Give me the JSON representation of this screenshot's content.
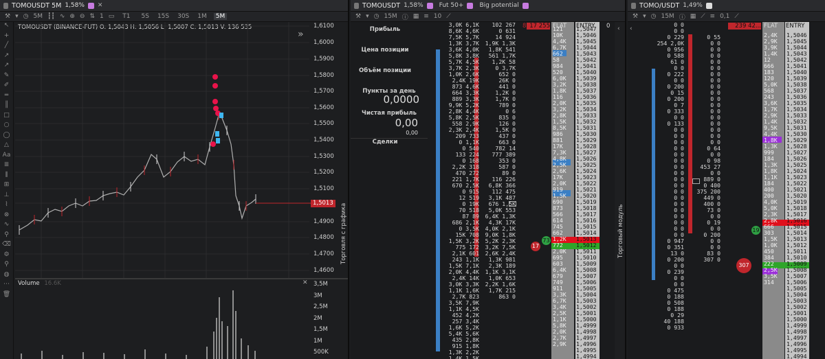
{
  "colors": {
    "bg": "#1c1d1f",
    "bid": "#3b7fc4",
    "ask": "#c0262c",
    "green": "#2ea043",
    "purple": "#9b30d9"
  },
  "p1": {
    "tab_title": "TOMOUSDT 5M",
    "tab_pct": "1,58%",
    "tf_active": "5M",
    "timeframes": [
      "T1",
      "5S",
      "15S",
      "30S",
      "1M",
      "5M"
    ],
    "interval": "5M",
    "count": "1",
    "ohlc": "TOMOUSDT (BINANCE-FUT) O: 1,5043  H: 1,5056  L: 1,5007  C: 1,5013  V: 136 535",
    "prices": [
      "1,6100",
      "1,6000",
      "1,5900",
      "1,5800",
      "1,5700",
      "1,5600",
      "1,5500",
      "1,5400",
      "1,5300",
      "1,5200",
      "1,5100",
      "1,5013",
      "1,4900",
      "1,4800",
      "1,4700",
      "1,4600"
    ],
    "current_price": "1,5013",
    "volume_label": "Volume",
    "volume_value": "16.6K",
    "vol_axis": [
      "3,5M",
      "3M",
      "2,5M",
      "2M",
      "1,5M",
      "1M",
      "500K"
    ],
    "vert_label": "Торговля с графика",
    "tools": [
      "cursor",
      "cross",
      "line",
      "ray",
      "arrow",
      "pencil",
      "brush",
      "hline",
      "vline",
      "rect",
      "circle",
      "ellipse",
      "triangle",
      "text",
      "fib",
      "channel",
      "measure",
      "ruler",
      "trash",
      "lock",
      "eye",
      "magnet",
      "eraser",
      "settings",
      "zoom",
      "hide",
      "more",
      "delete"
    ]
  },
  "p2": {
    "tab_title": "TOMOUSDT",
    "tab_pct": "1,58%",
    "tab2": "Fut 50+",
    "tab3": "Big potential",
    "interval": "15M",
    "count": "10",
    "header": {
      "bids": "8",
      "asks": "17 255",
      "flat": "FLAT",
      "entry": "ENTRY",
      "zero": "0"
    },
    "labels": {
      "profit": "Прибыль",
      "pos_price": "Цена позиции",
      "pos_vol": "Объём позиции",
      "day_points": "Пункты за день",
      "day_points_val": "0,0000",
      "net_profit": "Чистая прибыль",
      "net_val": "0,00",
      "net_sub": "0,00",
      "deals": "Сделки"
    },
    "circles": [
      "17",
      "73"
    ],
    "vert_label": "Торговый модуль",
    "c1": [
      "3,0K 6,1K",
      "8,6K 4,6K",
      "7,5K 5,7K",
      "1,3K 3,7K",
      "3,6K 4,0K",
      "5,8K 3,8K",
      "5,7K 4,5K",
      "3,7K 2,3K",
      "1,0K 2,6K",
      "2,4K 19K",
      "873 4,6K",
      "664 3,3K",
      "889 3,3K",
      "9,9K 5,2K",
      "2,8K 4,4K",
      "5,8K 2,5K",
      "558 2,9K",
      "2,3K 2,4K",
      "209 733",
      "0 1,1K",
      "0 540",
      "133 224",
      "0 168",
      "2,2K 318",
      "470 272",
      "221 1,7K",
      "670 2,5K",
      "0 915",
      "12 519",
      "0 19K",
      "70 518",
      "87 89",
      "686 2,1K",
      "0 3,5K",
      "15K 708",
      "1,5K 3,2K",
      "775 172",
      "2,1K 601",
      "243 1,1K",
      "1,5K 7,1K",
      "2,0K 4,4K",
      "2,4K 14K",
      "3,0K 3,3K",
      "1,1K 1,6K",
      "2,7K 823",
      "3,5K 7,9K",
      "1,1K 4,5K",
      "452 4,2K",
      "257 3,4K",
      "1,6K 5,2K",
      "5,4K 5,6K",
      "435 2,8K",
      "915 1,8K",
      "1,3K 2,2K",
      "1,4K 1,5K",
      "1,9K 3,5K",
      "1,8K 23K"
    ],
    "c2": [
      "102 267",
      "0 631",
      "14 924",
      "1,9K 1,3K",
      "1,8K 541",
      "561 1,7K",
      "1,2K 58",
      "0 3,7K",
      "652 0",
      "26K 0",
      "441 0",
      "1,2K 0",
      "1,7K 0",
      "789 0",
      "0 6",
      "835 0",
      "126 0",
      "1,5K 0",
      "437 0",
      "663 0",
      "782 14",
      "777 389",
      "353 0",
      "587 0",
      "89 0",
      "116 226",
      "6,8K 366",
      "112 475",
      "3,1K 487",
      "676 1,5K",
      "5,0K 553",
      "6,4K 1,3K",
      "4,3K 17K",
      "4,0K 2,1K",
      "9,0K 1,8K",
      "5,2K 2,3K",
      "3,2K 7,5K",
      "2,6K 2,4K",
      "1,3K 981",
      "2,3K 189",
      "1,1K 3,1K",
      "1,0K 653",
      "2,2K 1,6K",
      "1,7K 215",
      "863 0"
    ],
    "asks": [
      "",
      "",
      "",
      "121",
      "10K",
      "4,4K",
      "6,7K",
      "662",
      "58",
      "984",
      "520",
      "6,0K",
      "3,2K",
      "1,8K",
      "116",
      "2,0K",
      "3,2K",
      "2,8K",
      "1,5K",
      "8,5K",
      "986",
      "881",
      "17K",
      "7,3K",
      "4,8K",
      "2,5K",
      "2,6K",
      "17K",
      "2,0K",
      "919",
      "1,5K",
      "690",
      "873",
      "566",
      "614",
      "745",
      "662",
      "1,2K",
      "772",
      "2,0K",
      "695",
      "603",
      "6,4K",
      "679",
      "749",
      "911",
      "3,3K",
      "6,7K",
      "3,4K",
      "2,5K",
      "1,1K",
      "5,8K",
      "2,0K",
      "2,7K",
      "2,9K"
    ],
    "prices": [
      "1,5047",
      "1,5046",
      "1,5045",
      "1,5044",
      "1,5043",
      "1,5042",
      "1,5041",
      "1,5040",
      "1,5039",
      "1,5038",
      "1,5037",
      "1,5036",
      "1,5035",
      "1,5034",
      "1,5033",
      "1,5032",
      "1,5031",
      "1,5030",
      "1,5029",
      "1,5028",
      "1,5027",
      "1,5026",
      "1,5025",
      "1,5024",
      "1,5023",
      "1,5022",
      "1,5021",
      "1,5020",
      "1,5019",
      "1,5018",
      "1,5017",
      "1,5016",
      "1,5015",
      "1,5014",
      "1,5013",
      "1,5012",
      "1,5011",
      "1,5010",
      "1,5009",
      "1,5008",
      "1,5007",
      "1,5006",
      "1,5005",
      "1,5004",
      "1,5003",
      "1,5002",
      "1,5001",
      "1,5000",
      "1,4999",
      "1,4998",
      "1,4997",
      "1,4996",
      "1,4995",
      "1,4994"
    ]
  },
  "p3": {
    "tab_title": "TOMO/USDT",
    "tab_pct": "1,49%",
    "interval": "15M",
    "count": "0,1",
    "header": {
      "asks": "239 42...",
      "flat": "FLAT",
      "entry": "ENTRY"
    },
    "circles": [
      "19",
      "307"
    ],
    "c1": [
      "0 0",
      "0 0",
      "0 229",
      "254 2,0K",
      "0 956",
      "0 588",
      "61 0",
      "0 0",
      "0 222",
      "0 0",
      "0 200",
      "0 15",
      "0 200",
      "0 7",
      "0 333",
      "0 0",
      "0 133",
      "0 0",
      "0 0",
      "0 0",
      "0 0",
      "0 0",
      "0 0",
      "0 0",
      "0 0",
      "0 0",
      "0 0",
      "0 0",
      "0 0",
      "0 0",
      "0 0",
      "0 0",
      "0 0",
      "0 0",
      "0 0",
      "0 947",
      "0 351",
      "13 0",
      "0 200",
      "0 0",
      "0 239",
      "0 0",
      "0 0",
      "0 475",
      "0 188",
      "0 508",
      "0 188",
      "0 29",
      "40 188",
      "0 933"
    ],
    "c2": [
      "0 55",
      "0 0",
      "0 0",
      "0 0",
      "0 0",
      "0 0",
      "0 0",
      "0 0",
      "0 0",
      "0 0",
      "0 0",
      "0 0",
      "0 0",
      "0 0",
      "0 0",
      "0 0",
      "0 0",
      "0 0",
      "0 64",
      "0 0",
      "0 98",
      "453 27",
      "0 0",
      "889 0",
      "0 400",
      "375 200",
      "449 0",
      "400 0",
      "73 0",
      "0 0",
      "0 19",
      "0 0",
      "0 200",
      "0 0",
      "0 0",
      "83 0",
      "307 0"
    ],
    "asks": [
      "2,4K",
      "2,9K",
      "3,9K",
      "1,4K",
      "",
      "12",
      "666",
      "183",
      "",
      "120",
      "5,0K",
      "568",
      "243",
      "3,6K",
      "1,7K",
      "2,9K",
      "1,4K",
      "9,5K",
      "4,4K",
      "1,8K",
      "1,3K",
      "999",
      "184",
      "1,3K",
      "1,8K",
      "1,1K",
      "184",
      "",
      "",
      "",
      "400",
      "200",
      "",
      "",
      "",
      "",
      "",
      "",
      "4,0K",
      "5,0K",
      "2,3K",
      "2,8K",
      "666",
      "",
      "303",
      "1,5K",
      "1,0K",
      "450",
      "384",
      "222",
      "2,5K",
      "3,5K",
      "314"
    ],
    "prices": [
      "1,5046",
      "1,5045",
      "1,5044",
      "1,5043",
      "1,5042",
      "1,5041",
      "1,5040",
      "1,5039",
      "1,5038",
      "1,5037",
      "1,5036",
      "1,5035",
      "1,5034",
      "1,5033",
      "1,5032",
      "1,5031",
      "1,5030",
      "1,5029",
      "1,5028",
      "1,5027",
      "1,5026",
      "1,5025",
      "1,5024",
      "1,5023",
      "1,5022",
      "1,5021",
      "1,5020",
      "1,5019",
      "1,5018",
      "1,5017",
      "1,5016",
      "1,5015",
      "1,5014",
      "1,5013",
      "1,5012",
      "1,5011",
      "1,5010",
      "1,5009",
      "1,5008",
      "1,5007",
      "1,5006",
      "1,5005",
      "1,5004",
      "1,5003",
      "1,5002",
      "1,5001",
      "1,5000",
      "1,4999",
      "1,4998",
      "1,4997",
      "1,4996",
      "1,4995",
      "1,4994",
      "1,4993"
    ]
  }
}
